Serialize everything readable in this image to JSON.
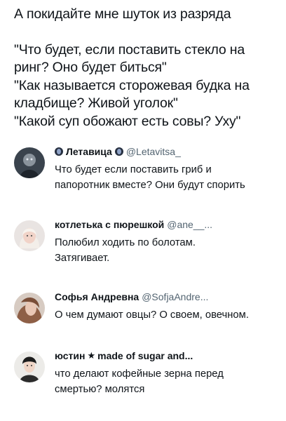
{
  "post": {
    "lines_top": [
      "А покидайте мне шуток из разряда"
    ],
    "lines_bottom": [
      "\"Что будет, если поставить стекло на",
      "ринг? Оно будет биться\"",
      "\"Как называется сторожевая будка на",
      "кладбище? Живой уголок\"",
      "\"Какой суп обожают есть совы? Уху\""
    ]
  },
  "replies": [
    {
      "name": "Летавица",
      "handle": "@Letavitsa_",
      "avatar": "dark-figure-avatar",
      "text": [
        "Что будет если поставить гриб и",
        "папоротник вместе? Они будут спорить"
      ]
    },
    {
      "name": "котлетька с пюрешкой",
      "handle": "@ane__...",
      "avatar": "blonde-girl-avatar",
      "text": [
        "Полюбил ходить по болотам.",
        "Затягивает."
      ]
    },
    {
      "name": "Софья Андревна",
      "handle": "@SofjaAndre...",
      "avatar": "brown-hair-avatar",
      "text": [
        "О чем думают овцы? О своем, овечном."
      ]
    },
    {
      "name_prefix": "юстин",
      "star": "★",
      "name_suffix": "made of sugar and...",
      "avatar": "girl-bangs-avatar",
      "text": [
        "что делают кофейные зерна перед",
        "смертью? молятся"
      ]
    }
  ]
}
